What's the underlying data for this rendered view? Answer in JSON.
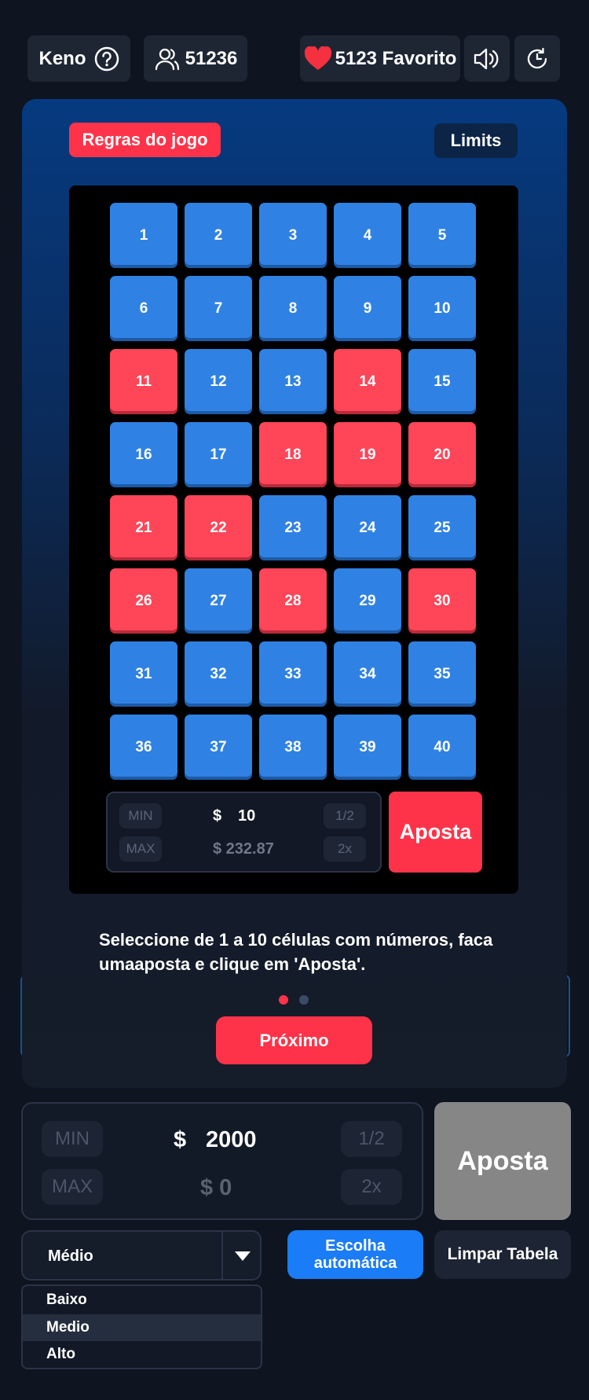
{
  "header": {
    "game_name": "Keno",
    "players_count": "51236",
    "favorites_label": "5123 Favorito",
    "icons": [
      "help-icon",
      "users-icon",
      "heart-icon",
      "speaker-icon",
      "history-icon"
    ]
  },
  "tutorial": {
    "rules_button": "Regras do jogo",
    "limits_button": "Limits",
    "numbers": [
      {
        "n": "1",
        "hit": false
      },
      {
        "n": "2",
        "hit": false
      },
      {
        "n": "3",
        "hit": false
      },
      {
        "n": "4",
        "hit": false
      },
      {
        "n": "5",
        "hit": false
      },
      {
        "n": "6",
        "hit": false
      },
      {
        "n": "7",
        "hit": false
      },
      {
        "n": "8",
        "hit": false
      },
      {
        "n": "9",
        "hit": false
      },
      {
        "n": "10",
        "hit": false
      },
      {
        "n": "11",
        "hit": true
      },
      {
        "n": "12",
        "hit": false
      },
      {
        "n": "13",
        "hit": false
      },
      {
        "n": "14",
        "hit": true
      },
      {
        "n": "15",
        "hit": false
      },
      {
        "n": "16",
        "hit": false
      },
      {
        "n": "17",
        "hit": false
      },
      {
        "n": "18",
        "hit": true
      },
      {
        "n": "19",
        "hit": true
      },
      {
        "n": "20",
        "hit": true
      },
      {
        "n": "21",
        "hit": true
      },
      {
        "n": "22",
        "hit": true
      },
      {
        "n": "23",
        "hit": false
      },
      {
        "n": "24",
        "hit": false
      },
      {
        "n": "25",
        "hit": false
      },
      {
        "n": "26",
        "hit": true
      },
      {
        "n": "27",
        "hit": false
      },
      {
        "n": "28",
        "hit": true
      },
      {
        "n": "29",
        "hit": false
      },
      {
        "n": "30",
        "hit": true
      },
      {
        "n": "31",
        "hit": false
      },
      {
        "n": "32",
        "hit": false
      },
      {
        "n": "33",
        "hit": false
      },
      {
        "n": "34",
        "hit": false
      },
      {
        "n": "35",
        "hit": false
      },
      {
        "n": "36",
        "hit": false
      },
      {
        "n": "37",
        "hit": false
      },
      {
        "n": "38",
        "hit": false
      },
      {
        "n": "39",
        "hit": false
      },
      {
        "n": "40",
        "hit": false
      }
    ],
    "mini_bet": {
      "min_label": "MIN",
      "max_label": "MAX",
      "currency": "$",
      "amount": "10",
      "max_value": "$ 232.87",
      "half_label": "1/2",
      "double_label": "2x",
      "bet_button": "Aposta"
    },
    "instruction": "Seleccione de 1 a 10 células com números, faca umaaposta e clique em 'Aposta'.",
    "next_button": "Próximo",
    "page_indicator": {
      "total": 2,
      "active": 1
    }
  },
  "bet": {
    "min_label": "MIN",
    "max_label": "MAX",
    "currency": "$",
    "amount": "2000",
    "max_value": "$ 0",
    "half_label": "1/2",
    "double_label": "2x",
    "bet_button": "Aposta"
  },
  "risk": {
    "selected": "Médio",
    "options": [
      "Baixo",
      "Medio",
      "Alto"
    ],
    "highlighted_index": 1
  },
  "auto_pick_button": [
    "Escolha",
    "automática"
  ],
  "clear_button": "Limpar Tabela",
  "colors": {
    "cell_blue": "#2f82e3",
    "cell_red": "#ff4558",
    "accent_red": "#fe3349",
    "accent_blue": "#1a7cf6",
    "disabled_gray": "#868686"
  }
}
